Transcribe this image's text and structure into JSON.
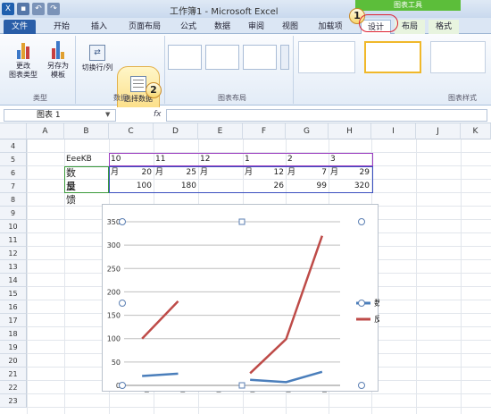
{
  "window": {
    "title": "工作簿1 - Microsoft Excel",
    "context_tools": "图表工具"
  },
  "tabs": [
    "文件",
    "开始",
    "插入",
    "页面布局",
    "公式",
    "数据",
    "审阅",
    "视图",
    "加载项",
    "设计",
    "布局",
    "格式"
  ],
  "ribbon": {
    "type_group": {
      "change_type": "更改\n图表类型",
      "save_template": "另存为\n模板",
      "label": "类型"
    },
    "data_group": {
      "switch_row_col": "切换行/列",
      "select_data": "选择数据",
      "label": "数据"
    },
    "layout_group": {
      "label": "图表布局"
    },
    "style_group": {
      "label": "图表样式"
    }
  },
  "namebox": "图表 1",
  "fx": "fx",
  "columns": [
    "A",
    "B",
    "C",
    "D",
    "E",
    "F",
    "G",
    "H",
    "I",
    "J",
    "K"
  ],
  "rows": [
    "4",
    "5",
    "6",
    "7",
    "8",
    "9",
    "10",
    "11",
    "12",
    "13",
    "14",
    "15",
    "16",
    "17",
    "18",
    "19",
    "20",
    "21",
    "22",
    "23"
  ],
  "table": {
    "header": [
      "EeeKB",
      "10月",
      "11月",
      "12月",
      "1月",
      "2月",
      "3月"
    ],
    "row1_label": "数量",
    "row1": [
      "20",
      "25",
      "",
      "12",
      "7",
      "29"
    ],
    "row2_label": "反馈",
    "row2": [
      "100",
      "180",
      "",
      "26",
      "99",
      "320"
    ]
  },
  "callouts": [
    "1",
    "2"
  ],
  "chart_data": {
    "type": "line",
    "categories": [
      "10月",
      "11月",
      "12月",
      "1月",
      "2月",
      "3月"
    ],
    "series": [
      {
        "name": "数量",
        "values": [
          20,
          25,
          null,
          12,
          7,
          29
        ],
        "color": "#4a7ebb"
      },
      {
        "name": "反馈",
        "values": [
          100,
          180,
          null,
          26,
          99,
          320
        ],
        "color": "#be4b48"
      }
    ],
    "yticks": [
      "0",
      "50",
      "100",
      "150",
      "200",
      "250",
      "300",
      "350"
    ],
    "ylim": [
      0,
      350
    ],
    "legend_position": "right"
  }
}
